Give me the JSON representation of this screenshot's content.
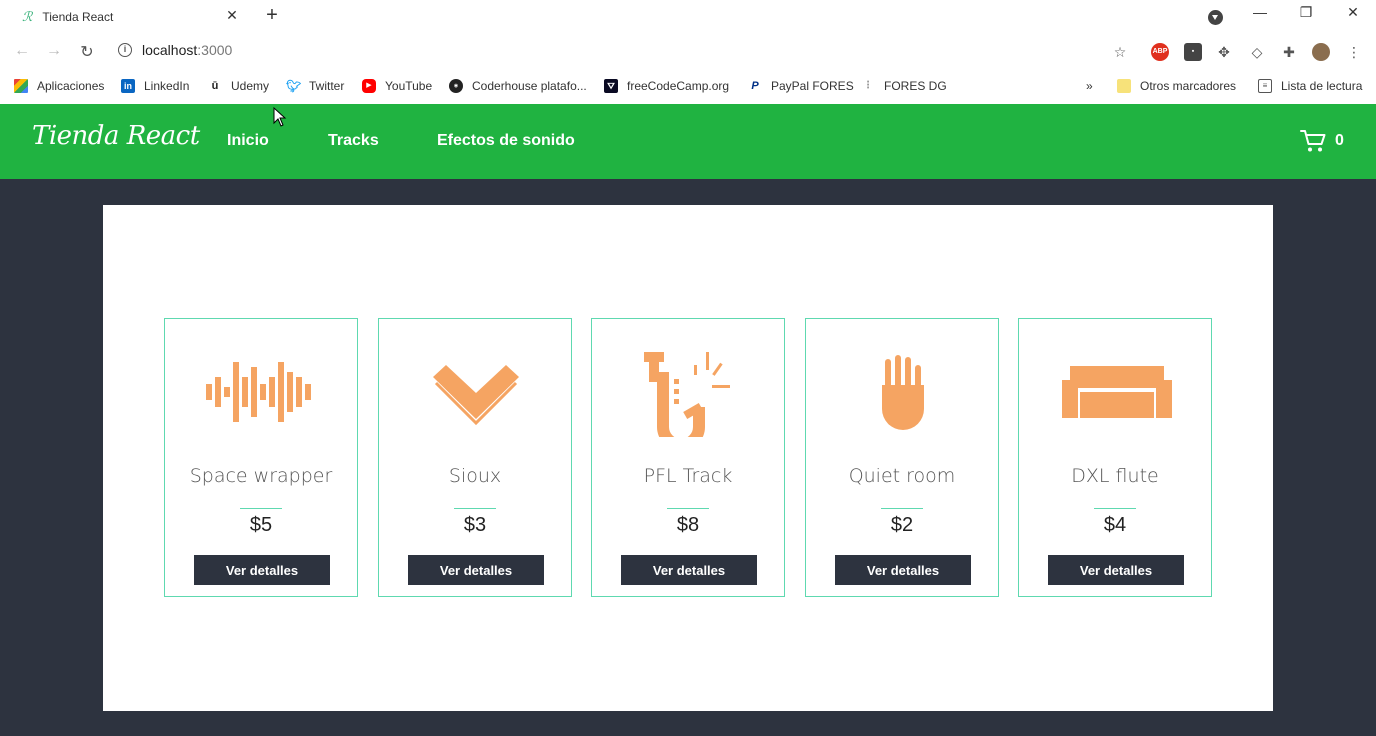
{
  "browser": {
    "tab_title": "Tienda React",
    "url_host": "localhost",
    "url_port": ":3000",
    "bookmarks": [
      {
        "label": "Aplicaciones",
        "icon": "apps-grid-icon"
      },
      {
        "label": "LinkedIn",
        "icon": "linkedin-icon"
      },
      {
        "label": "Udemy",
        "icon": "udemy-icon"
      },
      {
        "label": "Twitter",
        "icon": "twitter-icon"
      },
      {
        "label": "YouTube",
        "icon": "youtube-icon"
      },
      {
        "label": "Coderhouse platafo...",
        "icon": "coderhouse-icon"
      },
      {
        "label": "freeCodeCamp.org",
        "icon": "freecodecamp-icon"
      },
      {
        "label": "PayPal FORES",
        "icon": "paypal-icon"
      },
      {
        "label": "FORES DG",
        "icon": "dots-icon"
      }
    ],
    "other_bookmarks": "Otros marcadores",
    "reading_list": "Lista de lectura",
    "more": "»"
  },
  "header": {
    "logo": "Tienda React",
    "nav": [
      "Inicio",
      "Tracks",
      "Efectos de sonido"
    ],
    "cart_count": "0",
    "bg_color": "#20b341"
  },
  "products": [
    {
      "name": "Space wrapper",
      "price": "$5",
      "button": "Ver detalles",
      "icon": "sound-wave-icon"
    },
    {
      "name": "Sioux",
      "price": "$3",
      "button": "Ver detalles",
      "icon": "chevron-heart-icon"
    },
    {
      "name": "PFL Track",
      "price": "$8",
      "button": "Ver detalles",
      "icon": "saxophone-icon"
    },
    {
      "name": "Quiet room",
      "price": "$2",
      "button": "Ver detalles",
      "icon": "hand-icon"
    },
    {
      "name": "DXL flute",
      "price": "$4",
      "button": "Ver detalles",
      "icon": "sofa-icon"
    }
  ],
  "colors": {
    "accent": "#f5a462",
    "card_border": "#5ed9b0",
    "dark": "#2d333f"
  }
}
